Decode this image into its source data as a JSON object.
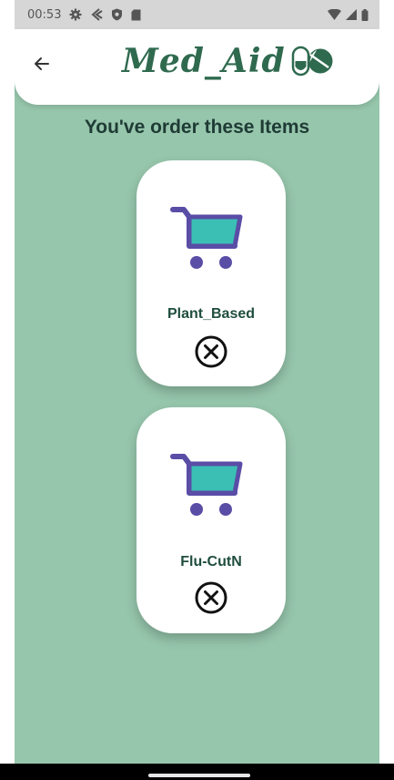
{
  "status_bar": {
    "time": "00:53",
    "icons_left": [
      "settings-icon",
      "nav-arrow-icon",
      "shield-icon",
      "sd-card-icon"
    ],
    "icons_right": [
      "wifi-icon",
      "signal-icon",
      "battery-icon"
    ]
  },
  "app_bar": {
    "back_icon": "back-arrow-icon",
    "logo_text": "Med_Aid",
    "logo_icon": "pill-capsule-icon"
  },
  "heading": "You've order these Items",
  "orders": [
    {
      "name": "Plant_Based",
      "icon": "cart-icon",
      "remove_icon": "remove-circle-icon"
    },
    {
      "name": "Flu-CutN",
      "icon": "cart-icon",
      "remove_icon": "remove-circle-icon"
    }
  ],
  "colors": {
    "background": "#96c6ac",
    "logo_green": "#2f6a4f",
    "cart_purple": "#5a4da6",
    "cart_teal": "#3bbfb5",
    "heading": "#1f3b35",
    "item_text": "#1f4e3d"
  }
}
